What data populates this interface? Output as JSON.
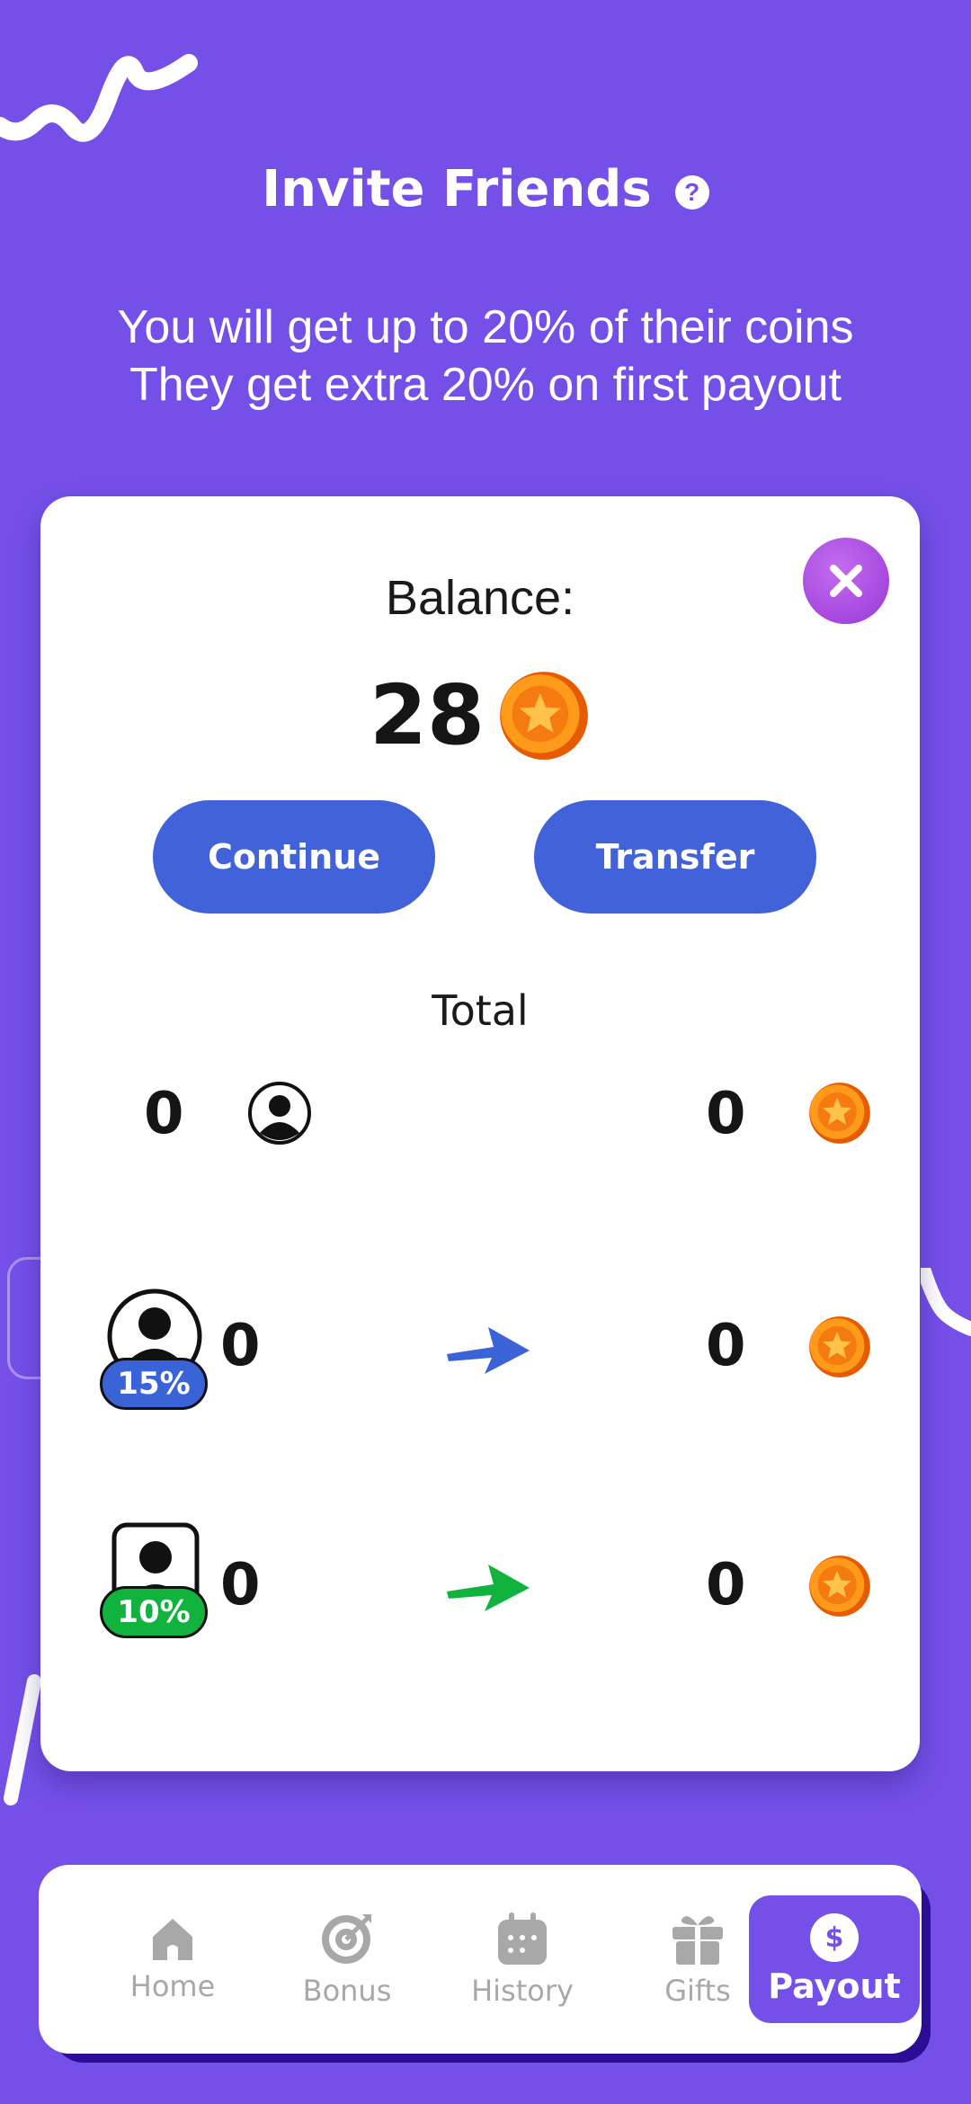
{
  "header": {
    "title": "Invite Friends",
    "subtitle_line1": "You will get up to 20% of their coins",
    "subtitle_line2": "They get extra 20% on first payout"
  },
  "card": {
    "balance_label": "Balance:",
    "balance_value": "28",
    "continue_label": "Continue",
    "transfer_label": "Transfer",
    "total_label": "Total",
    "total_row": {
      "friends": "0",
      "coins": "0"
    },
    "tier1_row": {
      "percent": "15%",
      "friends": "0",
      "coins": "0"
    },
    "tier2_row": {
      "percent": "10%",
      "friends": "0",
      "coins": "0"
    }
  },
  "nav": {
    "items": [
      {
        "label": "Home",
        "icon": "home-icon"
      },
      {
        "label": "Bonus",
        "icon": "target-icon"
      },
      {
        "label": "History",
        "icon": "calendar-icon"
      },
      {
        "label": "Gifts",
        "icon": "gift-icon"
      },
      {
        "label": "Payout",
        "icon": "dollar-icon",
        "active": true
      }
    ]
  },
  "colors": {
    "background": "#7450e8",
    "button_blue": "#4262d9",
    "tier1_blue": "#3b63d8",
    "tier2_green": "#12b23e",
    "close_purple": "#a94ae0",
    "coin_orange": "#ff8c00"
  }
}
